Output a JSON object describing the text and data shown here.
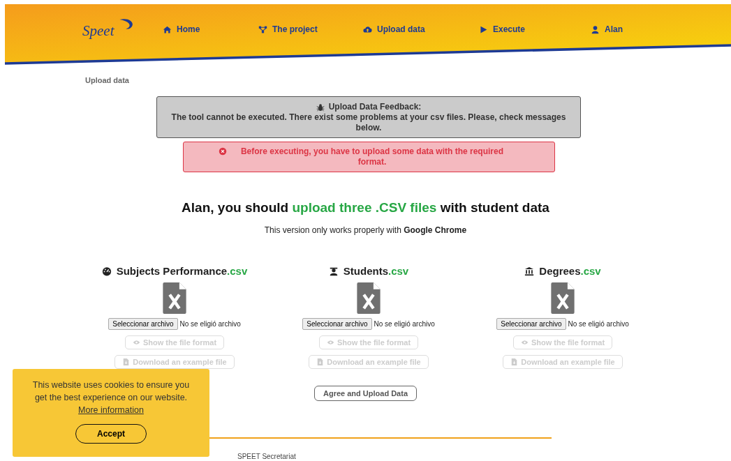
{
  "header": {
    "logo": "Speet",
    "nav": [
      {
        "label": "Home"
      },
      {
        "label": "The project"
      },
      {
        "label": "Upload data"
      },
      {
        "label": "Execute"
      },
      {
        "label": "Alan"
      }
    ]
  },
  "breadcrumb": "Upload data",
  "feedback": {
    "title": "Upload Data Feedback:",
    "message": "The tool cannot be executed. There exist some problems at your csv files. Please, check messages below."
  },
  "error": "Before executing, you have to upload some data with the required format.",
  "heading": {
    "before": "Alan, you should ",
    "highlight": "upload three .CSV files",
    "after": " with student data"
  },
  "note": "This version only works properly with **Google Chrome**",
  "files": [
    {
      "name": "Subjects Performance",
      "ext": ".csv",
      "choose": "Seleccionar archivo",
      "status": "No se eligió archivo",
      "format_button": {
        "label": "Show the file format",
        "disabled": true
      },
      "example_button": {
        "label": "Download an example file",
        "disabled": true
      }
    },
    {
      "name": "Students",
      "ext": ".csv",
      "choose": "Seleccionar archivo",
      "status": "No se eligió archivo",
      "format_button": {
        "label": "Show the file format",
        "disabled": true
      },
      "example_button": {
        "label": "Download an example file",
        "disabled": true
      }
    },
    {
      "name": "Degrees",
      "ext": ".csv",
      "choose": "Seleccionar archivo",
      "status": "No se eligió archivo",
      "format_button": {
        "label": "Show the file format",
        "disabled": true
      },
      "example_button": {
        "label": "Download an example file",
        "disabled": true
      }
    }
  ],
  "agree_button": "Agree and Upload Data",
  "footer": "SPEET Secretariat",
  "cookie": {
    "message": "This website uses cookies to ensure you get the best experience on our website.",
    "link": "More information",
    "accept": "Accept"
  }
}
